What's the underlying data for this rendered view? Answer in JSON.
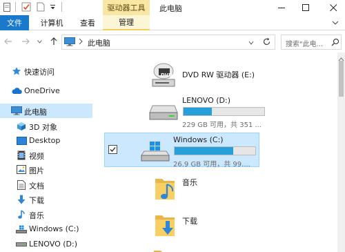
{
  "window": {
    "title": "此电脑"
  },
  "ribbon": {
    "context_group_label": "驱动器工具",
    "tabs": [
      {
        "label": "文件"
      },
      {
        "label": "计算机"
      },
      {
        "label": "查看"
      },
      {
        "label": "管理"
      }
    ]
  },
  "address": {
    "crumb": "此电脑"
  },
  "search": {
    "placeholder": "搜索\"此电..."
  },
  "nav": {
    "items": [
      {
        "label": "快速访问"
      },
      {
        "label": "OneDrive"
      },
      {
        "label": "此电脑"
      },
      {
        "label": "3D 对象"
      },
      {
        "label": "Desktop"
      },
      {
        "label": "视频"
      },
      {
        "label": "图片"
      },
      {
        "label": "文档"
      },
      {
        "label": "下载"
      },
      {
        "label": "音乐"
      },
      {
        "label": "Windows (C:)"
      },
      {
        "label": "LENOVO (D:)"
      }
    ]
  },
  "items": {
    "dvd": {
      "name": "DVD RW 驱动器 (E:)",
      "badge": "DVD"
    },
    "lenovo": {
      "name": "LENOVO (D:)",
      "free": "229 GB 可用，共 351 ...",
      "used_fraction": 0.35
    },
    "windows": {
      "name": "Windows (C:)",
      "free": "26.9 GB 可用，共 99....",
      "used_fraction": 0.73
    },
    "music": {
      "name": "音乐"
    },
    "downloads": {
      "name": "下载"
    }
  },
  "colors": {
    "accent": "#1979ca",
    "selection": "#cce8ff",
    "context_tab": "#f9e6a4",
    "usage_bar": "#26a0da"
  }
}
